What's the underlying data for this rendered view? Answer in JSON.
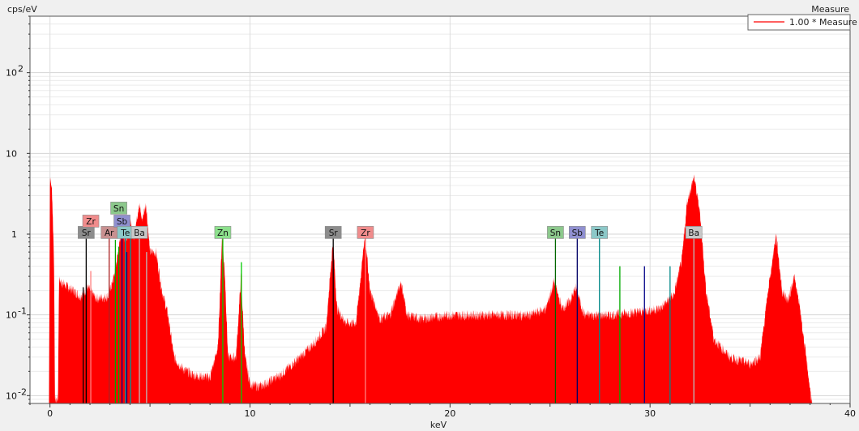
{
  "chart_data": {
    "type": "area",
    "title": "Measure",
    "ylabel": "cps/eV",
    "xlabel": "keV",
    "x_range": [
      -1,
      40
    ],
    "y_scale": "log",
    "y_range": [
      0.008,
      500
    ],
    "y_ticks": [
      {
        "value": 0.01,
        "base": "10",
        "exp": "-2"
      },
      {
        "value": 0.1,
        "base": "10",
        "exp": "-1"
      },
      {
        "value": 1,
        "base": "1",
        "exp": ""
      },
      {
        "value": 10,
        "base": "10",
        "exp": ""
      },
      {
        "value": 100,
        "base": "10",
        "exp": "2"
      }
    ],
    "x_ticks": [
      {
        "value": 0,
        "label": "0"
      },
      {
        "value": 10,
        "label": "10"
      },
      {
        "value": 20,
        "label": "20"
      },
      {
        "value": 30,
        "label": "30"
      },
      {
        "value": 40,
        "label": "40"
      }
    ],
    "grid": true,
    "legend": {
      "position": "top-right",
      "entries": [
        {
          "name": "1.00 * Measure",
          "color": "#ff0000"
        }
      ]
    },
    "series": [
      {
        "name": "1.00 * Measure",
        "color": "#ff0000",
        "points": [
          [
            -0.05,
            0.009
          ],
          [
            0.0,
            5.2
          ],
          [
            0.1,
            3.5
          ],
          [
            0.2,
            0.5
          ],
          [
            0.25,
            0.009
          ],
          [
            0.4,
            0.009
          ],
          [
            0.45,
            0.27
          ],
          [
            0.8,
            0.23
          ],
          [
            1.2,
            0.2
          ],
          [
            1.5,
            0.17
          ],
          [
            1.9,
            0.22
          ],
          [
            2.3,
            0.16
          ],
          [
            2.9,
            0.17
          ],
          [
            3.2,
            0.3
          ],
          [
            3.5,
            0.8
          ],
          [
            3.65,
            1.5
          ],
          [
            3.75,
            0.8
          ],
          [
            4.0,
            1.4
          ],
          [
            4.2,
            0.9
          ],
          [
            4.45,
            2.4
          ],
          [
            4.6,
            1.5
          ],
          [
            4.8,
            2.4
          ],
          [
            5.0,
            0.6
          ],
          [
            5.3,
            0.6
          ],
          [
            5.6,
            0.2
          ],
          [
            5.9,
            0.1
          ],
          [
            6.2,
            0.03
          ],
          [
            6.6,
            0.022
          ],
          [
            7.2,
            0.018
          ],
          [
            8.0,
            0.017
          ],
          [
            8.4,
            0.04
          ],
          [
            8.6,
            0.95
          ],
          [
            8.75,
            0.3
          ],
          [
            8.9,
            0.03
          ],
          [
            9.3,
            0.03
          ],
          [
            9.55,
            0.3
          ],
          [
            9.75,
            0.03
          ],
          [
            10.0,
            0.014
          ],
          [
            10.5,
            0.013
          ],
          [
            11.5,
            0.018
          ],
          [
            12.5,
            0.03
          ],
          [
            13.2,
            0.045
          ],
          [
            13.8,
            0.07
          ],
          [
            14.15,
            0.85
          ],
          [
            14.35,
            0.12
          ],
          [
            14.8,
            0.08
          ],
          [
            15.3,
            0.08
          ],
          [
            15.75,
            1.0
          ],
          [
            16.0,
            0.2
          ],
          [
            16.5,
            0.09
          ],
          [
            17.0,
            0.1
          ],
          [
            17.55,
            0.26
          ],
          [
            17.85,
            0.1
          ],
          [
            18.5,
            0.09
          ],
          [
            20.0,
            0.1
          ],
          [
            22.0,
            0.1
          ],
          [
            24.0,
            0.1
          ],
          [
            24.8,
            0.12
          ],
          [
            25.2,
            0.26
          ],
          [
            25.6,
            0.12
          ],
          [
            26.0,
            0.15
          ],
          [
            26.3,
            0.22
          ],
          [
            26.7,
            0.1
          ],
          [
            28.0,
            0.1
          ],
          [
            29.5,
            0.11
          ],
          [
            30.5,
            0.12
          ],
          [
            31.2,
            0.18
          ],
          [
            31.6,
            0.5
          ],
          [
            31.85,
            2.5
          ],
          [
            32.2,
            5.2
          ],
          [
            32.5,
            1.8
          ],
          [
            32.8,
            0.2
          ],
          [
            33.2,
            0.05
          ],
          [
            34.0,
            0.03
          ],
          [
            35.0,
            0.025
          ],
          [
            35.5,
            0.03
          ],
          [
            35.9,
            0.2
          ],
          [
            36.3,
            1.0
          ],
          [
            36.6,
            0.2
          ],
          [
            36.9,
            0.15
          ],
          [
            37.2,
            0.3
          ],
          [
            37.5,
            0.12
          ],
          [
            37.8,
            0.03
          ],
          [
            38.0,
            0.012
          ],
          [
            38.1,
            0.008
          ]
        ]
      }
    ],
    "lines": [
      {
        "x": 1.66,
        "h": 0.22,
        "color": "#000000"
      },
      {
        "x": 1.81,
        "h": 0.95,
        "color": "#000000"
      },
      {
        "x": 2.04,
        "h": 0.35,
        "color": "#ff7f7f"
      },
      {
        "x": 2.96,
        "h": 0.9,
        "color": "#aa2222"
      },
      {
        "x": 3.27,
        "h": 0.85,
        "color": "#00aa00"
      },
      {
        "x": 3.44,
        "h": 0.7,
        "color": "#00aa00"
      },
      {
        "x": 3.6,
        "h": 0.95,
        "color": "#000088"
      },
      {
        "x": 3.77,
        "h": 0.95,
        "color": "#009999"
      },
      {
        "x": 3.84,
        "h": 0.6,
        "color": "#000088"
      },
      {
        "x": 4.03,
        "h": 0.9,
        "color": "#009999"
      },
      {
        "x": 4.47,
        "h": 0.9,
        "color": "#bbbbbb"
      },
      {
        "x": 4.83,
        "h": 0.6,
        "color": "#bbbbbb"
      },
      {
        "x": 8.64,
        "h": 0.95,
        "color": "#00cc00"
      },
      {
        "x": 9.57,
        "h": 0.45,
        "color": "#00cc00"
      },
      {
        "x": 14.16,
        "h": 0.95,
        "color": "#000000"
      },
      {
        "x": 15.77,
        "h": 0.95,
        "color": "#ff7f7f"
      },
      {
        "x": 25.27,
        "h": 0.95,
        "color": "#006600"
      },
      {
        "x": 26.36,
        "h": 0.95,
        "color": "#000066"
      },
      {
        "x": 27.47,
        "h": 0.95,
        "color": "#008888"
      },
      {
        "x": 28.49,
        "h": 0.4,
        "color": "#00aa00"
      },
      {
        "x": 29.72,
        "h": 0.4,
        "color": "#000088"
      },
      {
        "x": 31.0,
        "h": 0.4,
        "color": "#008888"
      },
      {
        "x": 32.19,
        "h": 0.95,
        "color": "#bbbbbb"
      }
    ],
    "element_labels": [
      {
        "text": "Sr",
        "x": 1.81,
        "y": 1.05,
        "bg": "#8c8c8c"
      },
      {
        "text": "Zr",
        "x": 2.04,
        "y": 1.45,
        "bg": "#f08c8c"
      },
      {
        "text": "Ar",
        "x": 2.96,
        "y": 1.05,
        "bg": "#c89090"
      },
      {
        "text": "Sn",
        "x": 3.44,
        "y": 2.1,
        "bg": "#8cc88c"
      },
      {
        "text": "Sb",
        "x": 3.6,
        "y": 1.45,
        "bg": "#9090d0"
      },
      {
        "text": "Te",
        "x": 3.77,
        "y": 1.05,
        "bg": "#8cc8c8"
      },
      {
        "text": "Ba",
        "x": 4.47,
        "y": 1.05,
        "bg": "#c8c8c8"
      },
      {
        "text": "Zn",
        "x": 8.64,
        "y": 1.05,
        "bg": "#8ce08c"
      },
      {
        "text": "Sr",
        "x": 14.16,
        "y": 1.05,
        "bg": "#8c8c8c"
      },
      {
        "text": "Zr",
        "x": 15.77,
        "y": 1.05,
        "bg": "#f08c8c"
      },
      {
        "text": "Sn",
        "x": 25.27,
        "y": 1.05,
        "bg": "#8cc88c"
      },
      {
        "text": "Sb",
        "x": 26.36,
        "y": 1.05,
        "bg": "#9090d0"
      },
      {
        "text": "Te",
        "x": 27.47,
        "y": 1.05,
        "bg": "#8cc8c8"
      },
      {
        "text": "Ba",
        "x": 32.19,
        "y": 1.05,
        "bg": "#c8c8c8"
      }
    ]
  }
}
